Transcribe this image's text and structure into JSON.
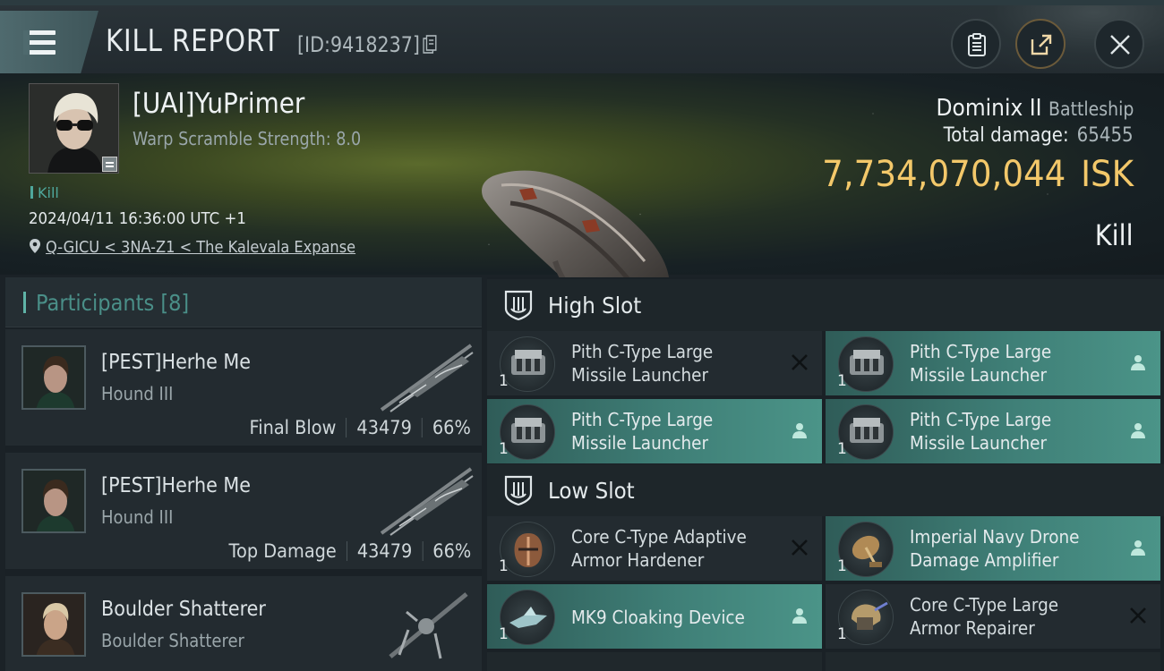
{
  "header": {
    "title": "KILL REPORT",
    "kill_id": "[ID:9418237]",
    "menu_icon": "hamburger-menu-icon",
    "buttons": [
      "clipboard-icon",
      "share-icon",
      "close-icon"
    ]
  },
  "victim": {
    "name": "[UAI]YuPrimer",
    "warp_scramble": "Warp Scramble Strength: 8.0",
    "status": "Kill",
    "timestamp": "2024/04/11 16:36:00 UTC +1",
    "location": "Q-GICU < 3NA-Z1 < The Kalevala Expanse",
    "ship_name": "Dominix II",
    "ship_class": "Battleship",
    "total_damage_label": "Total damage:",
    "total_damage_value": "65455",
    "isk_value": "7,734,070,044",
    "isk_unit": "ISK",
    "kill_type": "Kill"
  },
  "participants": {
    "title": "Participants [8]",
    "items": [
      {
        "name": "[PEST]Herhe Me",
        "ship": "Hound III",
        "role": "Final Blow",
        "damage": "43479",
        "percent": "66%"
      },
      {
        "name": "[PEST]Herhe Me",
        "ship": "Hound III",
        "role": "Top Damage",
        "damage": "43479",
        "percent": "66%"
      },
      {
        "name": "Boulder Shatterer",
        "ship": "Boulder Shatterer"
      }
    ]
  },
  "slots": {
    "high": {
      "title": "High Slot",
      "items": [
        {
          "name": "Pith C-Type Large Missile Launcher",
          "qty": "1",
          "state": "destroyed"
        },
        {
          "name": "Pith C-Type Large Missile Launcher",
          "qty": "1",
          "state": "dropped"
        },
        {
          "name": "Pith C-Type Large Missile Launcher",
          "qty": "1",
          "state": "dropped"
        },
        {
          "name": "Pith C-Type Large Missile Launcher",
          "qty": "1",
          "state": "dropped"
        }
      ]
    },
    "low": {
      "title": "Low Slot",
      "items": [
        {
          "name": "Core C-Type Adaptive Armor Hardener",
          "qty": "1",
          "state": "destroyed"
        },
        {
          "name": "Imperial Navy Drone Damage Amplifier",
          "qty": "1",
          "state": "dropped"
        },
        {
          "name": "MK9 Cloaking Device",
          "qty": "1",
          "state": "dropped"
        },
        {
          "name": "Core C-Type Large Armor Repairer",
          "qty": "1",
          "state": "destroyed"
        }
      ]
    }
  },
  "colors": {
    "accent_teal": "#4b9488",
    "isk_gold": "#f3c86a",
    "background": "#1b2227"
  }
}
